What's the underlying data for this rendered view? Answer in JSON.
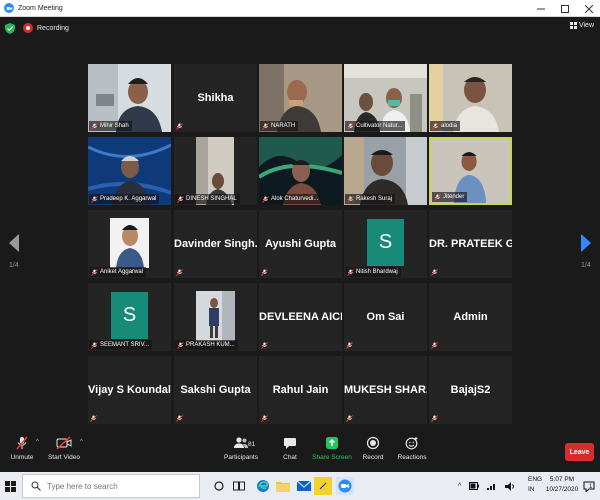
{
  "window": {
    "title": "Zoom Meeting"
  },
  "status": {
    "recording": "Recording",
    "view": "View"
  },
  "pager": {
    "left": "1/4",
    "right": "1/4"
  },
  "tiles": [
    {
      "label": "Mihir Shah"
    },
    {
      "name": "Shikha"
    },
    {
      "label": "NARATH"
    },
    {
      "label": "Cultivator Natur..."
    },
    {
      "label": "alodia"
    },
    {
      "label": "Pradeep K. Aggarwal"
    },
    {
      "label": "DINESH SINGHAL"
    },
    {
      "label": "Alok Chaturvedi..."
    },
    {
      "label": "Rakesh Suraj"
    },
    {
      "label": "Jitender"
    },
    {
      "label": "Aniket Aggarwal"
    },
    {
      "name": "Davinder  Singh..."
    },
    {
      "name": "Ayushi Gupta"
    },
    {
      "label": "Nitish Bhardwaj",
      "initial": "S"
    },
    {
      "name": "DR. PRATEEK G..."
    },
    {
      "label": "SEEMANT SRIV...",
      "initial": "S"
    },
    {
      "label": "PRAKASH KUM..."
    },
    {
      "name": "DEVLEENA AICH"
    },
    {
      "name": "Om Sai"
    },
    {
      "name": "Admin"
    },
    {
      "name": "Vijay S Koundal"
    },
    {
      "name": "Sakshi Gupta"
    },
    {
      "name": "Rahul Jain"
    },
    {
      "name": "MUKESH  SHAR..."
    },
    {
      "name": "BajajS2"
    }
  ],
  "toolbar": {
    "unmute": "Unmute",
    "start_video": "Start Video",
    "participants": "Participants",
    "participants_count": "81",
    "chat": "Chat",
    "share_screen": "Share Screen",
    "record": "Record",
    "reactions": "Reactions",
    "leave": "Leave"
  },
  "taskbar": {
    "search_placeholder": "Type here to search",
    "lang_top": "ENG",
    "lang_bottom": "IN",
    "time": "5:07 PM",
    "date": "10/27/2020",
    "notification_count": "1"
  },
  "colors": {
    "accent_blue": "#2d8cff",
    "leave_red": "#d92b2b",
    "share_green": "#22c55e",
    "active_speaker": "#c8d84a"
  }
}
